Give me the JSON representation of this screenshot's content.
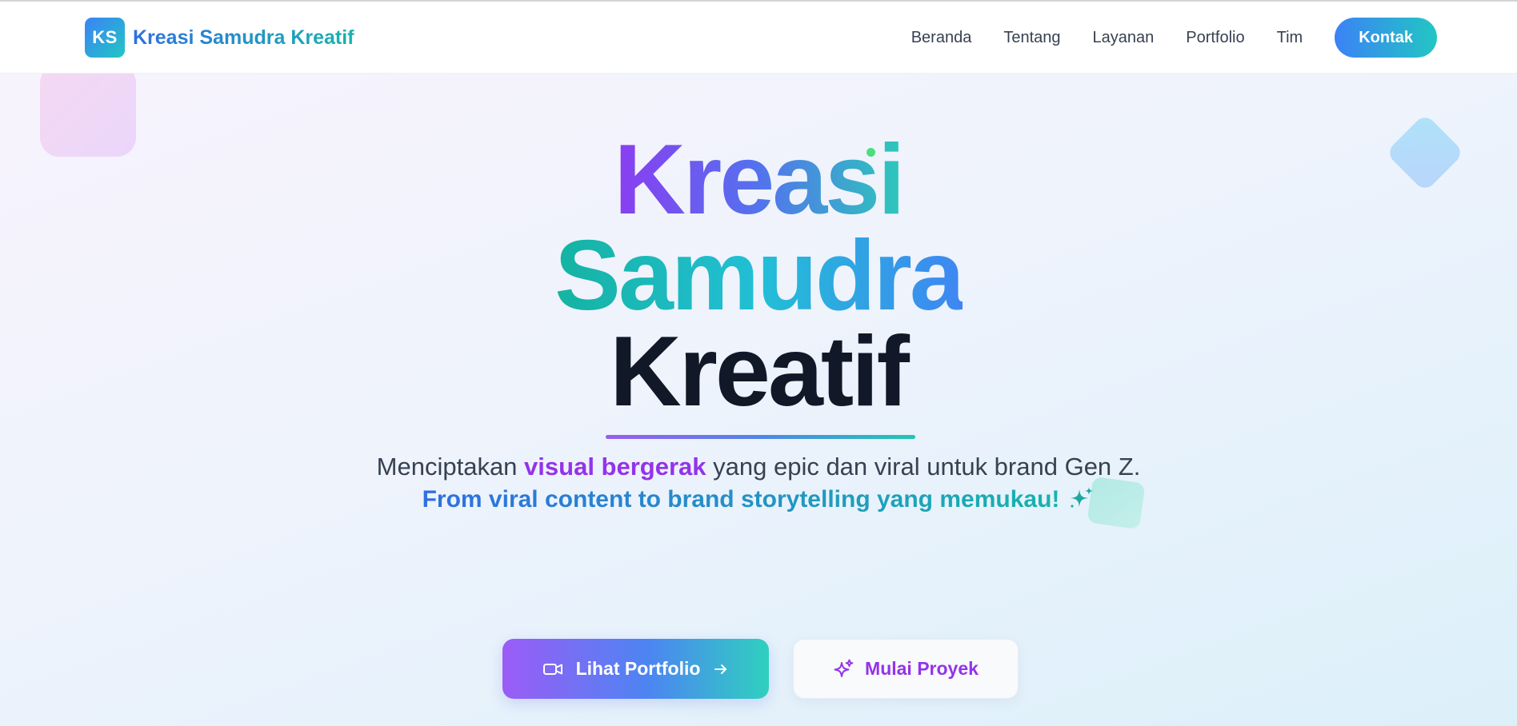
{
  "brand": {
    "logo_initials": "KS",
    "name": "Kreasi Samudra Kreatif",
    "colors": {
      "gradient_start": "#3b82f6",
      "gradient_end": "#22c6c3",
      "accent_purple": "#9333ea",
      "title_dark": "#111827"
    }
  },
  "nav": {
    "items": [
      {
        "label": "Beranda"
      },
      {
        "label": "Tentang"
      },
      {
        "label": "Layanan"
      },
      {
        "label": "Portfolio"
      },
      {
        "label": "Tim"
      }
    ],
    "cta_label": "Kontak"
  },
  "hero": {
    "title_line1": "Kreasi",
    "title_line2": "Samudra",
    "title_line3": "Kreatif",
    "subtitle_prefix": "Menciptakan ",
    "subtitle_highlight": "visual bergerak",
    "subtitle_suffix": " yang epic dan viral untuk brand Gen Z.",
    "tagline": "From viral content to brand storytelling yang memukau!",
    "tagline_icon": "sparkles-icon",
    "primary_button": {
      "label": "Lihat Portfolio",
      "icon": "video-camera-icon",
      "trailing_icon": "arrow-right-icon"
    },
    "secondary_button": {
      "label": "Mulai Proyek",
      "icon": "sparkles-icon"
    }
  }
}
